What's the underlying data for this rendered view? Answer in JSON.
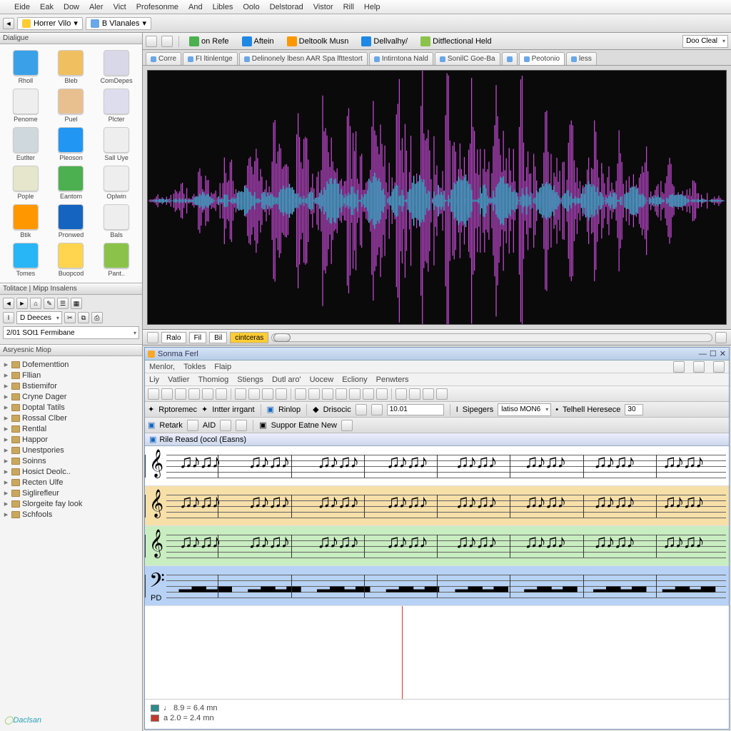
{
  "menubar": [
    "Eide",
    "Eak",
    "Dow",
    "Aler",
    "Vict",
    "Profesonme",
    "And",
    "Libles",
    "Oolo",
    "Delstorad",
    "Vistor",
    "Rill",
    "Help"
  ],
  "topstrip": {
    "tab1": "Horrer Vilo",
    "tab2": "B Vlanales",
    "end_label": "Doo Cleal"
  },
  "left": {
    "panel1": "Dialigue",
    "palette": [
      {
        "label": "Rholl",
        "color": "#3aa0e8"
      },
      {
        "label": "Bleb",
        "color": "#f0c060"
      },
      {
        "label": "ComDepes",
        "color": "#d8d8e8"
      },
      {
        "label": "Penome",
        "color": "#eeeeee"
      },
      {
        "label": "Puel",
        "color": "#e8c090"
      },
      {
        "label": "Plcter",
        "color": "#dde"
      },
      {
        "label": "Eutlter",
        "color": "#cfd8dc"
      },
      {
        "label": "Pleoson",
        "color": "#2196f3"
      },
      {
        "label": "Sall Uye",
        "color": "#eee"
      },
      {
        "label": "Pople",
        "color": "#e6e6cc"
      },
      {
        "label": "Eantom",
        "color": "#4caf50"
      },
      {
        "label": "Oplwin",
        "color": "#eee"
      },
      {
        "label": "Btik",
        "color": "#ff9800"
      },
      {
        "label": "Pronwed",
        "color": "#1565c0"
      },
      {
        "label": "Bals",
        "color": "#eee"
      },
      {
        "label": "Tomes",
        "color": "#29b6f6"
      },
      {
        "label": "Buopcod",
        "color": "#ffd54f"
      },
      {
        "label": "Pant..",
        "color": "#8bc34a"
      }
    ],
    "midlabel": "Tolitace | Mipp Insalens",
    "combo1": "D Deeces",
    "combo2": "2/01 SOt1 Fermibane",
    "treehdr": "Asryesnic Miop",
    "tree": [
      "Dofementtion",
      "Fllian",
      "Bstiemifor",
      "Cryne Dager",
      "Doptal Tatils",
      "Rossal Clber",
      "Rentlal",
      "Happor",
      "Unestpories",
      "Soinns",
      "Hosict Deolc..",
      "Recten Ulfe",
      "Siglirefleur",
      "Slorgeite fay look",
      "Schfools"
    ]
  },
  "right": {
    "toolbar": [
      {
        "icon": "#4caf50",
        "label": "on Refe"
      },
      {
        "icon": "#1e88e5",
        "label": "Aftein"
      },
      {
        "icon": "#ff9800",
        "label": "Deltoolk Musn"
      },
      {
        "icon": "#1e88e5",
        "label": "Dellvalhy/"
      },
      {
        "icon": "#8bc34a",
        "label": "Ditflectional Held"
      }
    ],
    "tabs": [
      "Corre",
      "FI ltinlentge",
      "Delinonely lbesn AAR Spa lfttestort",
      "Intirntona Nald",
      "SonilC Goe-Ba",
      "",
      "Peotonio",
      "less"
    ],
    "activeTab": 6,
    "transport": {
      "b1": "Ralo",
      "b2": "Fil",
      "b3": "Bil",
      "b4": "cintceras"
    }
  },
  "child": {
    "title": "Sonma Ferl",
    "menu": [
      "Menlor,",
      "Tokles",
      "Flaip"
    ],
    "menu2": [
      "Liy",
      "Vatlier",
      "Thomiog",
      "Stiengs",
      "Dutl aro'",
      "Uocew",
      "Ecliony",
      "Penwters"
    ],
    "row2": {
      "l1": "Rptoremec",
      "l2": "Intter irrgant",
      "l3": "Rinlop",
      "l4": "Drisocic",
      "numfield": "10.01",
      "l5": "Sipegers",
      "sel": "latiso MON6",
      "l6": "Telhell Heresece",
      "num2": "30"
    },
    "row3": {
      "l1": "Retark",
      "l2": "AID",
      "l3": "Suppor Eatne New"
    },
    "tab": "Rile Reasd (ocol (Easns)",
    "pd": "PD",
    "legend": [
      {
        "color": "#2e8b8b",
        "text": "♩ 8.9 = 6.4 mn"
      },
      {
        "color": "#c0392b",
        "text": "a 2.0 = 2.4 mn"
      }
    ]
  },
  "brand": "Daclsan"
}
